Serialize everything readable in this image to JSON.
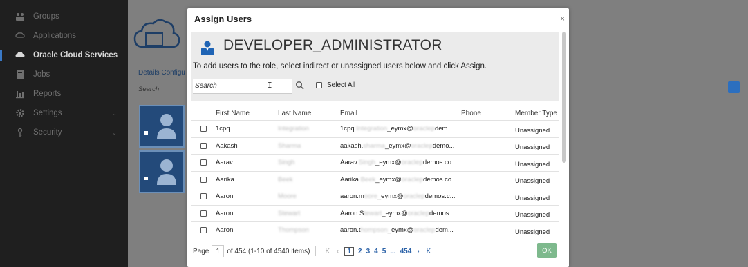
{
  "sidebar": {
    "items": [
      {
        "label": "Groups",
        "icon": "groups-icon",
        "active": false
      },
      {
        "label": "Applications",
        "icon": "applications-icon",
        "active": false
      },
      {
        "label": "Oracle Cloud Services",
        "icon": "cloud-icon",
        "active": true
      },
      {
        "label": "Jobs",
        "icon": "jobs-icon",
        "active": false
      },
      {
        "label": "Reports",
        "icon": "reports-icon",
        "active": false
      },
      {
        "label": "Settings",
        "icon": "settings-icon",
        "active": false,
        "expandable": true
      },
      {
        "label": "Security",
        "icon": "security-icon",
        "active": false,
        "expandable": true
      }
    ]
  },
  "background": {
    "tabs": "Details  Configu",
    "search_placeholder": "Search"
  },
  "modal": {
    "title": "Assign Users",
    "close_glyph": "×",
    "role_name": "DEVELOPER_ADMINISTRATOR",
    "instructions": "To add users to the role, select indirect or unassigned users below and click Assign.",
    "search_placeholder": "Search",
    "select_all_label": "Select All",
    "columns": {
      "first_name": "First Name",
      "last_name": "Last Name",
      "email": "Email",
      "phone": "Phone",
      "member_type": "Member Type"
    },
    "rows": [
      {
        "first": "1cpq",
        "last": "Integration",
        "email_a": "1cpq.",
        "email_b": "Integration",
        "email_c": "_eymx@",
        "email_d": "oraclep",
        "email_e": "dem...",
        "phone": "",
        "type": "Unassigned"
      },
      {
        "first": "Aakash",
        "last": "Sharma",
        "email_a": "aakash.",
        "email_b": "sharma",
        "email_c": "_eymx@",
        "email_d": "oraclep",
        "email_e": "demo...",
        "phone": "",
        "type": "Unassigned"
      },
      {
        "first": "Aarav",
        "last": "Singh",
        "email_a": "Aarav.",
        "email_b": "Singh",
        "email_c": "_eymx@",
        "email_d": "oraclep",
        "email_e": "demos.co...",
        "phone": "",
        "type": "Unassigned"
      },
      {
        "first": "Aarika",
        "last": "Beek",
        "email_a": "Aarika.",
        "email_b": "Beek",
        "email_c": "_eymx@",
        "email_d": "oraclep",
        "email_e": "demos.co...",
        "phone": "",
        "type": "Unassigned"
      },
      {
        "first": "Aaron",
        "last": "Moore",
        "email_a": "aaron.m",
        "email_b": "oore",
        "email_c": "_eymx@",
        "email_d": "oraclep",
        "email_e": "demos.c...",
        "phone": "",
        "type": "Unassigned"
      },
      {
        "first": "Aaron",
        "last": "Stewart",
        "email_a": "Aaron.S",
        "email_b": "tewart",
        "email_c": "_eymx@",
        "email_d": "oraclep",
        "email_e": "demos....",
        "phone": "",
        "type": "Unassigned"
      },
      {
        "first": "Aaron",
        "last": "Thompson",
        "email_a": "aaron.t",
        "email_b": "hompson",
        "email_c": "_eymx@",
        "email_d": "oraclep",
        "email_e": "dem...",
        "phone": "",
        "type": "Unassigned"
      }
    ],
    "pagination": {
      "page_label": "Page",
      "current_page": "1",
      "of_text": "of 454  (1-10 of 4540 items)",
      "first": "K",
      "prev": "‹",
      "pages": [
        "1",
        "2",
        "3",
        "4",
        "5"
      ],
      "ellipsis": "...",
      "last_page": "454",
      "next": "›",
      "last": "K"
    },
    "ok_label": "OK"
  },
  "colors": {
    "sidebar_bg": "#1f1f1f",
    "accent": "#3a79c6",
    "ok_button": "#7eb98d",
    "link": "#2d63a8"
  }
}
